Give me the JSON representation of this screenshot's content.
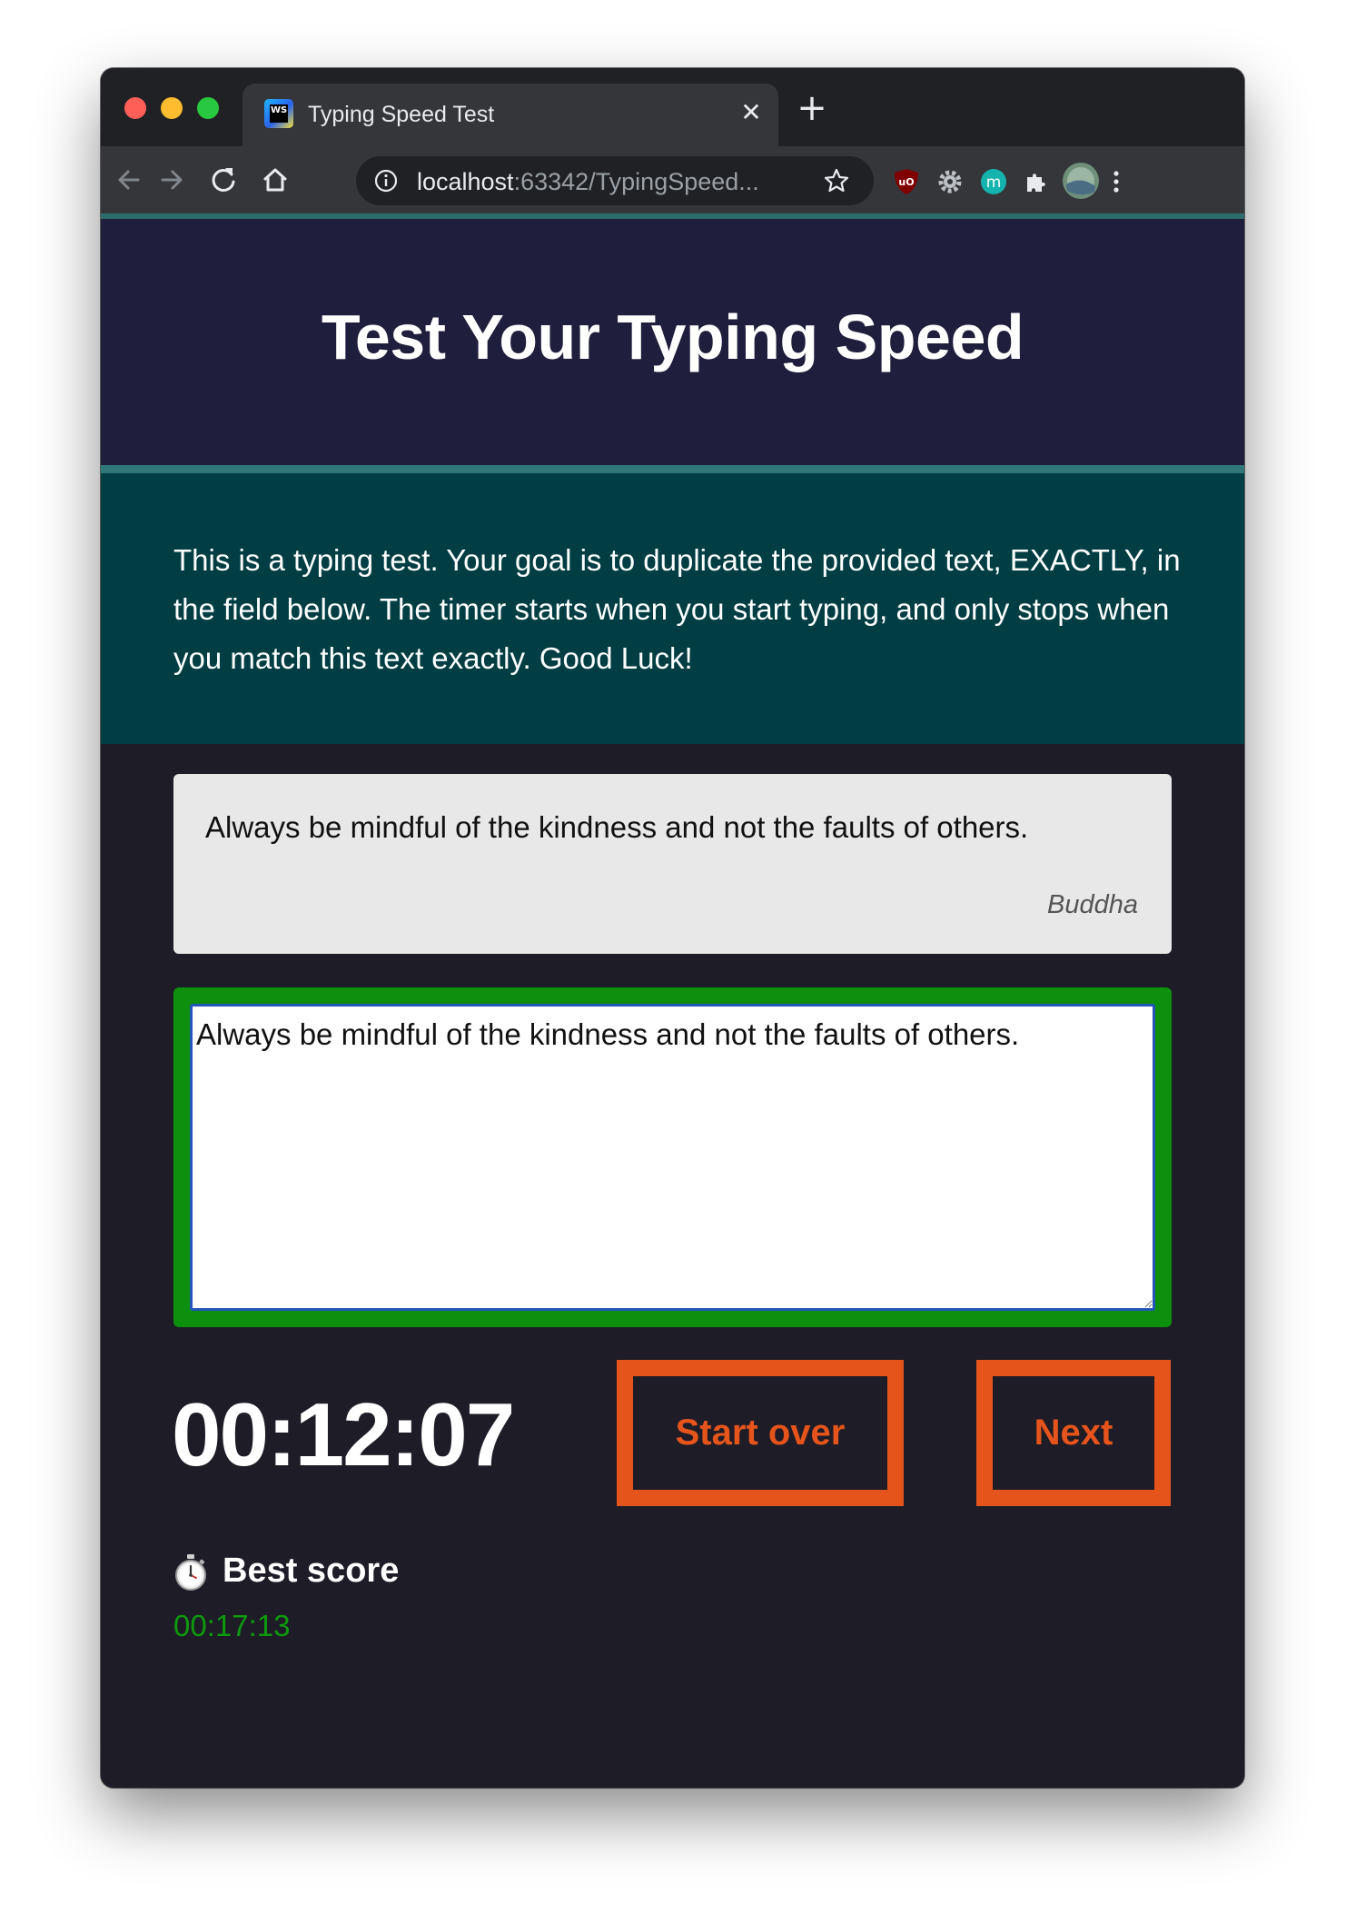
{
  "browser": {
    "tab_title": "Typing Speed Test",
    "tab_close_glyph": "✕",
    "new_tab_glyph": "+",
    "url_host": "localhost",
    "url_rest": ":63342/TypingSpeed..."
  },
  "header": {
    "title": "Test Your Typing Speed"
  },
  "intro": {
    "text": "This is a typing test. Your goal is to duplicate the provided text, EXACTLY, in the field below. The timer starts when you start typing, and only stops when you match this text exactly. Good Luck!"
  },
  "quote": {
    "text": "Always be mindful of the kindness and not the faults of others.",
    "author": "Buddha"
  },
  "input": {
    "value": "Always be mindful of the kindness and not the faults of others.",
    "status": "match"
  },
  "timer": {
    "value": "00:12:07"
  },
  "buttons": {
    "start_over": "Start over",
    "next": "Next"
  },
  "best_score": {
    "label": "Best score",
    "value": "00:17:13"
  },
  "colors": {
    "header_bg": "#1f1e3c",
    "intro_bg": "#003e44",
    "page_bg": "#1e1c26",
    "match_border": "#0e8f0e",
    "button_accent": "#e5541b",
    "best_value": "#0e9a0e"
  }
}
